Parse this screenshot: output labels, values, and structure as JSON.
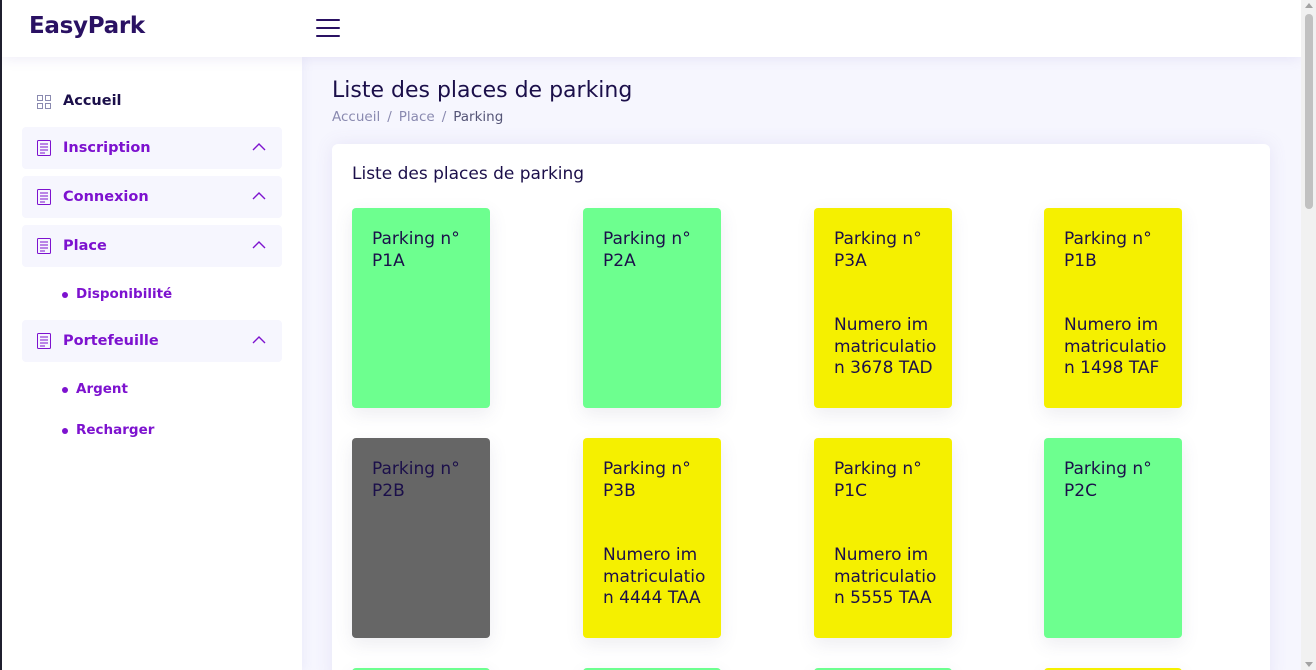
{
  "app": {
    "brand": "EasyPark"
  },
  "sidebar": {
    "home": {
      "label": "Accueil",
      "icon": "grid-icon"
    },
    "items": [
      {
        "label": "Inscription",
        "icon": "document-icon",
        "expanded": true
      },
      {
        "label": "Connexion",
        "icon": "document-icon",
        "expanded": true
      },
      {
        "label": "Place",
        "icon": "document-icon",
        "expanded": true,
        "children": [
          {
            "label": "Disponibilité"
          }
        ]
      },
      {
        "label": "Portefeuille",
        "icon": "document-icon",
        "expanded": true,
        "children": [
          {
            "label": "Argent"
          },
          {
            "label": "Recharger"
          }
        ]
      }
    ]
  },
  "page": {
    "title": "Liste des places de parking",
    "breadcrumb": [
      "Accueil",
      "Place",
      "Parking"
    ]
  },
  "card": {
    "title": "Liste des places de parking",
    "spots": [
      {
        "name": "Parking n° P1A",
        "status": "free",
        "color": "#6dff8f",
        "plate": ""
      },
      {
        "name": "Parking n° P2A",
        "status": "free",
        "color": "#6dff8f",
        "plate": ""
      },
      {
        "name": "Parking n° P3A",
        "status": "occupied",
        "color": "#f5f000",
        "plate": "Numero immatriculation 3678 TAD"
      },
      {
        "name": "Parking n° P1B",
        "status": "occupied",
        "color": "#f5f000",
        "plate": "Numero immatriculation 1498 TAF"
      },
      {
        "name": "Parking n° P2B",
        "status": "unavailable",
        "color": "#666666",
        "plate": ""
      },
      {
        "name": "Parking n° P3B",
        "status": "occupied",
        "color": "#f5f000",
        "plate": "Numero immatriculation 4444 TAA"
      },
      {
        "name": "Parking n° P1C",
        "status": "occupied",
        "color": "#f5f000",
        "plate": "Numero immatriculation 5555 TAA"
      },
      {
        "name": "Parking n° P2C",
        "status": "free",
        "color": "#6dff8f",
        "plate": ""
      }
    ],
    "partial_row_colors": [
      "#6dff8f",
      "#6dff8f",
      "#6dff8f",
      "#f5f000"
    ]
  },
  "colors": {
    "accent": "#7d12cf",
    "brand": "#2a1163",
    "free": "#6dff8f",
    "occupied": "#f5f000",
    "unavailable": "#666666"
  }
}
